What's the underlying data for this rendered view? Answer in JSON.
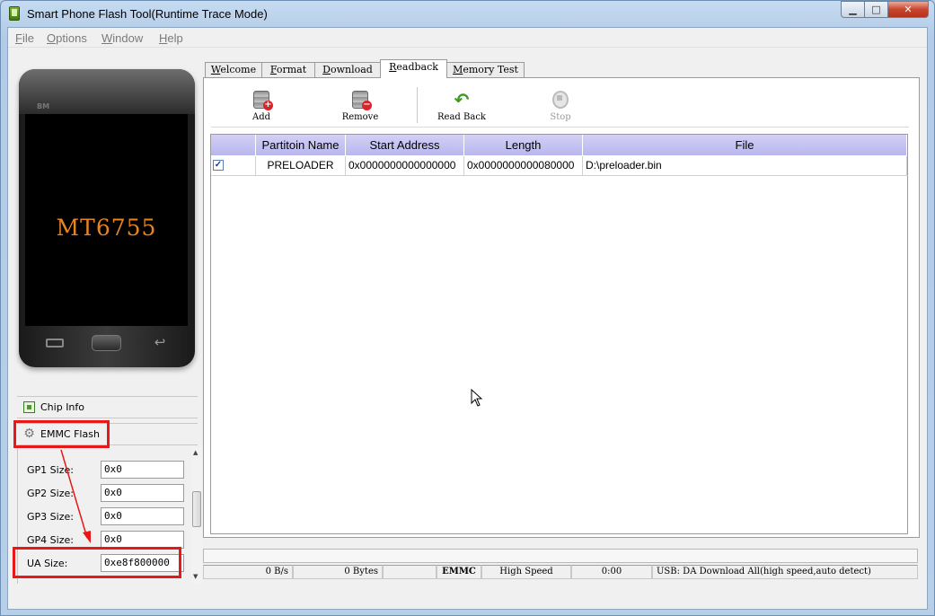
{
  "window": {
    "title": "Smart Phone Flash Tool(Runtime Trace Mode)",
    "min_glyph": "▁",
    "max_glyph": "□",
    "close_glyph": "✕"
  },
  "menu": {
    "items": [
      "File",
      "Options",
      "Window",
      "Help"
    ]
  },
  "phone": {
    "brand": "BM",
    "chip": "MT6755"
  },
  "left_panel": {
    "chip_info_label": "Chip Info",
    "emmc_flash_label": "EMMC Flash",
    "fields": [
      {
        "label": "GP1 Size:",
        "value": "0x0"
      },
      {
        "label": "GP2 Size:",
        "value": "0x0"
      },
      {
        "label": "GP3 Size:",
        "value": "0x0"
      },
      {
        "label": "GP4 Size:",
        "value": "0x0"
      },
      {
        "label": "UA Size:",
        "value": "0xe8f800000"
      }
    ]
  },
  "tabs": [
    {
      "label": "Welcome",
      "active": false
    },
    {
      "label": "Format",
      "active": false
    },
    {
      "label": "Download",
      "active": false
    },
    {
      "label": "Readback",
      "active": true
    },
    {
      "label": "Memory Test",
      "active": false
    }
  ],
  "toolbar": {
    "add": "Add",
    "remove": "Remove",
    "read_back": "Read Back",
    "stop": "Stop"
  },
  "table": {
    "headers": [
      "",
      "Partitoin Name",
      "Start Address",
      "Length",
      "File"
    ],
    "rows": [
      {
        "checked": "✓",
        "name": "PRELOADER",
        "start": "0x0000000000000000",
        "length": "0x0000000000080000",
        "file": "D:\\preloader.bin"
      }
    ]
  },
  "status": {
    "speed": "0 B/s",
    "bytes": "0 Bytes",
    "storage": "EMMC",
    "mode": "High Speed",
    "time": "0:00",
    "usb": "USB: DA Download All(high speed,auto detect)"
  },
  "colors": {
    "table_header": "#c4c2f1",
    "highlight": "#e81818",
    "chip_text": "#e88420"
  }
}
